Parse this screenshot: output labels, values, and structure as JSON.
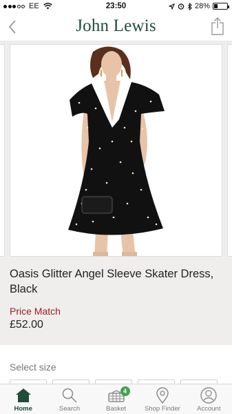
{
  "status_bar": {
    "carrier": "EE",
    "time": "23:50",
    "battery": "28%",
    "battery_level": 0.28
  },
  "header": {
    "logo": "John Lewis",
    "back_icon": "chevron-left-icon",
    "share_icon": "share-icon"
  },
  "product": {
    "title": "Oasis Glitter Angel Sleeve Skater Dress, Black",
    "price_match": "Price Match",
    "price": "£52.00"
  },
  "size": {
    "label": "Select size"
  },
  "tabs": [
    {
      "label": "Home",
      "icon": "home-icon",
      "active": true
    },
    {
      "label": "Search",
      "icon": "search-icon",
      "active": false
    },
    {
      "label": "Basket",
      "icon": "basket-icon",
      "active": false,
      "badge": "4"
    },
    {
      "label": "Shop Finder",
      "icon": "location-pin-icon",
      "active": false
    },
    {
      "label": "Account",
      "icon": "account-icon",
      "active": false
    }
  ],
  "colors": {
    "brand_green": "#1f4d3a",
    "price_match_red": "#9b1b1b",
    "badge_green": "#3fa34d",
    "panel_grey": "#efeeec"
  }
}
